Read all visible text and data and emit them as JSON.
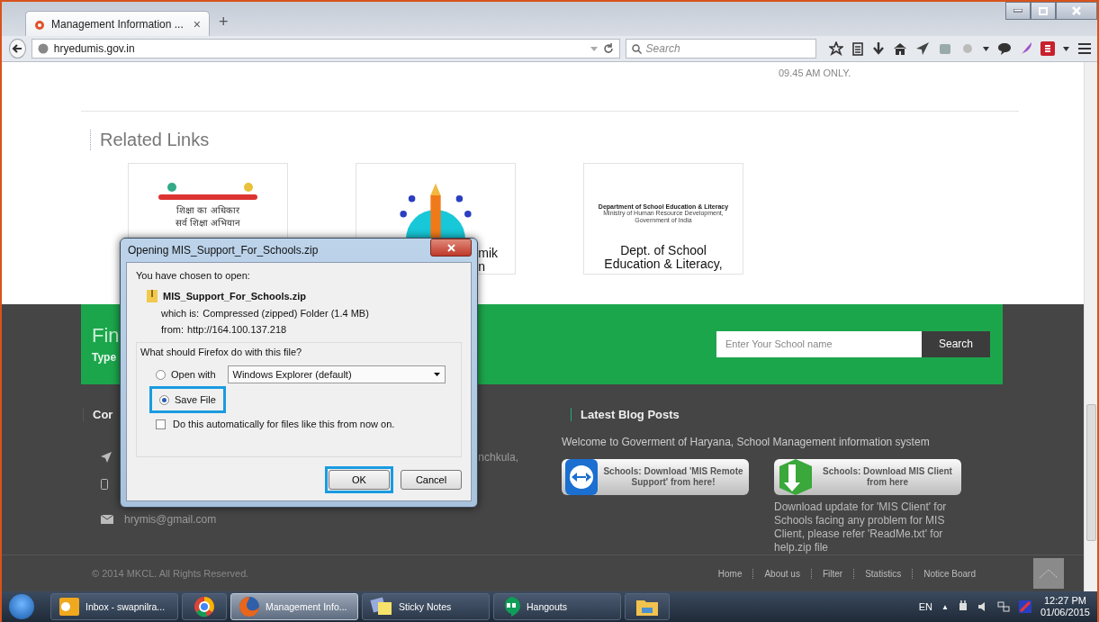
{
  "browser": {
    "tab": {
      "title": "Management Information ...",
      "close": "×"
    },
    "new_tab": "+",
    "url": "hryedumis.gov.in",
    "search": {
      "placeholder": "Search"
    }
  },
  "page": {
    "notice_tail": "09.45 AM ONLY.",
    "related_links": {
      "heading": "Related Links",
      "cards": [
        {
          "kind": "rte",
          "logo_lines": [
            "शिक्षा का अधिकार",
            "सर्व शिक्षा अभियान"
          ]
        },
        {
          "kind": "emblem",
          "text_lines": [
            "mik",
            "n"
          ]
        },
        {
          "kind": "dept",
          "logo_lines": [
            "Department of School Education & Literacy",
            "Ministry of Human Resource Development, Government of India"
          ],
          "text_lines": [
            "Dept. of School",
            "Education & Literacy,"
          ]
        }
      ]
    },
    "find_school": {
      "title": "Fin",
      "subtitle": "Type",
      "search": {
        "placeholder": "Enter Your School name"
      },
      "search_button": "Search"
    },
    "contact": {
      "heading": "Cor",
      "address_tail": "nchkula,",
      "email": "hrymis@gmail.com"
    },
    "blog": {
      "heading": "Latest Blog Posts",
      "intro": "Welcome to Goverment of Haryana, School Management information system",
      "downloads": [
        {
          "kind": "remote",
          "label": "Schools: Download 'MIS Remote Support' from here!"
        },
        {
          "kind": "client",
          "label": "Schools: Download MIS Client from here"
        }
      ],
      "note": "Download update for 'MIS Client' for Schools facing any problem for MIS Client, please refer 'ReadMe.txt' for help.zip file"
    },
    "footer": {
      "copyright": "© 2014 MKCL. All Rights Reserved.",
      "nav": [
        "Home",
        "About us",
        "Filter",
        "Statistics",
        "Notice Board"
      ]
    }
  },
  "dialog": {
    "title": "Opening MIS_Support_For_Schools.zip",
    "intro": "You have chosen to open:",
    "file_name": "MIS_Support_For_Schools.zip",
    "details": [
      {
        "label": "which is:",
        "value": "Compressed (zipped) Folder (1.4 MB)"
      },
      {
        "label": "from:",
        "value": "http://164.100.137.218"
      }
    ],
    "question": "What should Firefox do with this file?",
    "options": [
      {
        "kind": "open_with",
        "label": "Open with",
        "selected": false,
        "highlighted": false,
        "app": "Windows Explorer (default)"
      },
      {
        "kind": "save",
        "label": "Save File",
        "selected": true,
        "highlighted": true
      }
    ],
    "auto": {
      "label": "Do this automatically for files like this from now on.",
      "checked": false
    },
    "buttons": [
      {
        "label": "OK",
        "highlighted": true
      },
      {
        "label": "Cancel",
        "highlighted": false
      }
    ]
  },
  "taskbar": {
    "items": [
      {
        "kind": "outlook",
        "label": "Inbox - swapnilra...",
        "selected": false
      },
      {
        "kind": "chrome",
        "selected": false
      },
      {
        "kind": "firefox",
        "label": "Management Info...",
        "selected": true
      },
      {
        "kind": "sticky",
        "label": "Sticky Notes",
        "selected": false
      },
      {
        "kind": "hangouts",
        "label": "Hangouts",
        "selected": false
      },
      {
        "kind": "explorer",
        "selected": false
      }
    ],
    "language": "EN",
    "tray_arrow": "▲",
    "time": "12:27 PM",
    "date": "01/06/2015"
  }
}
